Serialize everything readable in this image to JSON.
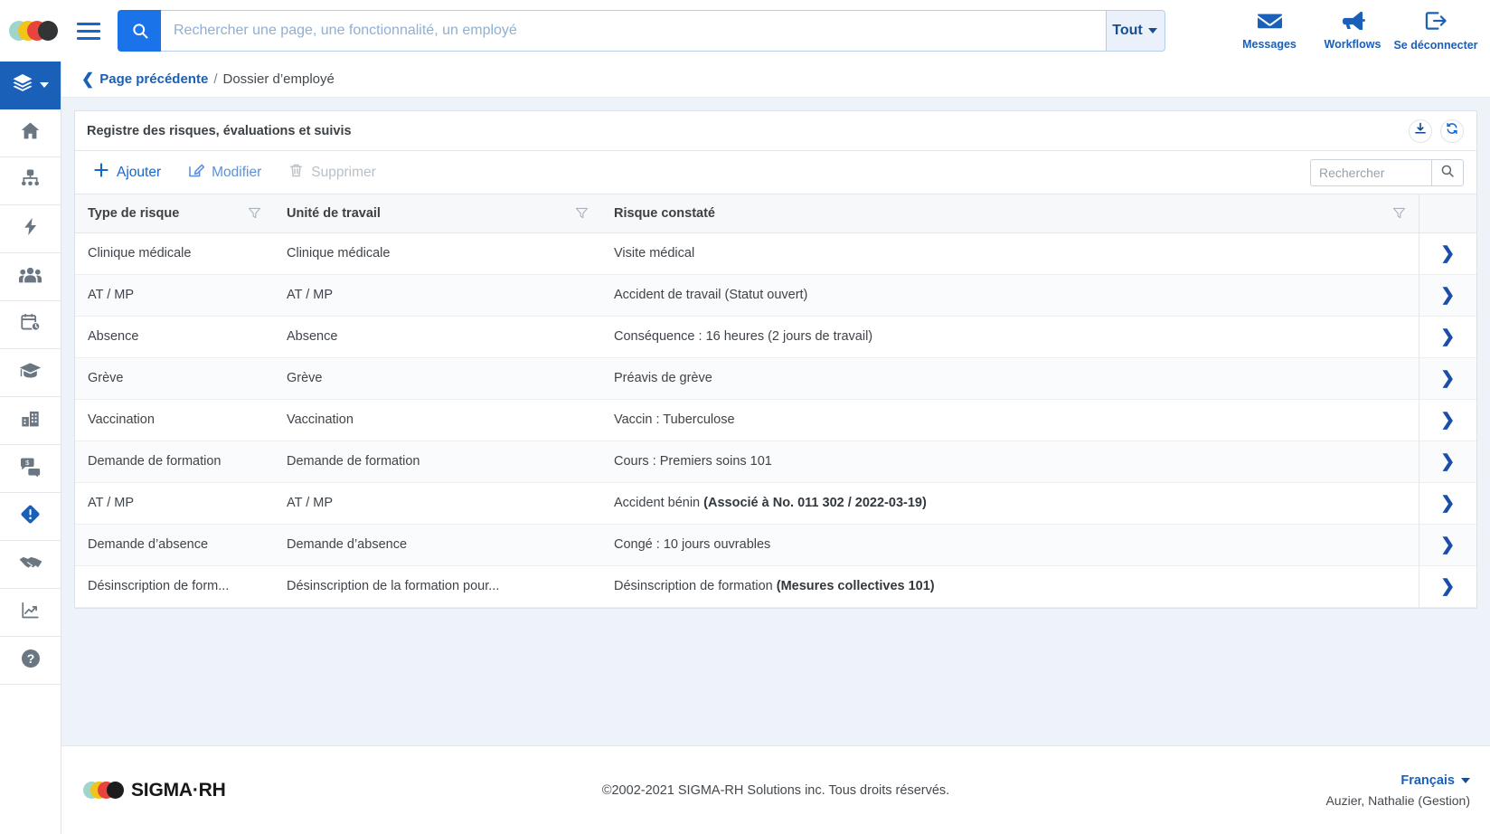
{
  "topbar": {
    "logo_name": "sigma-rh-dots-logo",
    "menu_label": "Menu",
    "search": {
      "placeholder": "Rechercher une page, une fonctionnalité, un employé",
      "value": "",
      "scope_label": "Tout"
    },
    "actions": [
      {
        "label": "Messages",
        "icon": "envelope-icon"
      },
      {
        "label": "Workflows",
        "icon": "megaphone-icon"
      },
      {
        "label": "Se déconnecter",
        "icon": "logout-icon"
      }
    ]
  },
  "sidebar": {
    "items": [
      {
        "name": "layers",
        "icon": "layers-icon",
        "active": true
      },
      {
        "name": "accueil",
        "icon": "home-icon",
        "active": false
      },
      {
        "name": "organigramme",
        "icon": "org-chart-icon",
        "active": false
      },
      {
        "name": "actions-rapides",
        "icon": "lightning-icon",
        "active": false
      },
      {
        "name": "employes",
        "icon": "people-icon",
        "active": false
      },
      {
        "name": "temps-presences",
        "icon": "calendar-clock-icon",
        "active": false
      },
      {
        "name": "formation",
        "icon": "graduation-cap-icon",
        "active": false
      },
      {
        "name": "entreprise",
        "icon": "building-icon",
        "active": false
      },
      {
        "name": "remuneration",
        "icon": "money-chat-icon",
        "active": false
      },
      {
        "name": "sante-securite",
        "icon": "alert-diamond-icon",
        "active": false
      },
      {
        "name": "relations-travail",
        "icon": "handshake-icon",
        "active": false
      },
      {
        "name": "rapports",
        "icon": "chart-line-icon",
        "active": false
      },
      {
        "name": "aide",
        "icon": "help-circle-icon",
        "active": false
      }
    ]
  },
  "breadcrumb": {
    "back_label": "Page précédente",
    "separator": "/",
    "current": "Dossier d’employé"
  },
  "panel": {
    "title": "Registre des risques, évaluations et suivis",
    "header_actions": [
      {
        "label": "Exporter",
        "icon": "download-icon"
      },
      {
        "label": "Rafraîchir",
        "icon": "refresh-icon"
      }
    ],
    "toolbar": {
      "add_label": "Ajouter",
      "edit_label": "Modifier",
      "delete_label": "Supprimer",
      "search_placeholder": "Rechercher",
      "search_value": ""
    },
    "table": {
      "columns": [
        {
          "label": "Type de risque",
          "filter": true
        },
        {
          "label": "Unité de travail",
          "filter": true
        },
        {
          "label": "Risque constaté",
          "filter": true
        }
      ],
      "rows": [
        {
          "type": "Clinique médicale",
          "unite": "Clinique médicale",
          "risque": "Visite médical",
          "risque_bold": ""
        },
        {
          "type": "AT / MP",
          "unite": "AT / MP",
          "risque": "Accident de travail (Statut ouvert)",
          "risque_bold": ""
        },
        {
          "type": "Absence",
          "unite": "Absence",
          "risque": "Conséquence : 16 heures (2 jours de travail)",
          "risque_bold": ""
        },
        {
          "type": "Grève",
          "unite": "Grève",
          "risque": "Préavis de grève",
          "risque_bold": ""
        },
        {
          "type": "Vaccination",
          "unite": "Vaccination",
          "risque": "Vaccin : Tuberculose",
          "risque_bold": ""
        },
        {
          "type": "Demande de formation",
          "unite": "Demande de formation",
          "risque": "Cours : Premiers soins 101",
          "risque_bold": ""
        },
        {
          "type": "AT / MP",
          "unite": "AT / MP",
          "risque": "Accident bénin ",
          "risque_bold": "(Associé à No. 011 302 / 2022-03-19)"
        },
        {
          "type": "Demande d’absence",
          "unite": "Demande d’absence",
          "risque": "Congé : 10 jours ouvrables",
          "risque_bold": ""
        },
        {
          "type": "Désinscription de form...",
          "unite": "Désinscription de la formation pour...",
          "risque": "Désinscription de formation ",
          "risque_bold": "(Mesures collectives 101)"
        }
      ],
      "row_action_icon": "chevron-right-icon"
    }
  },
  "footer": {
    "brand": "SIGMA·RH",
    "copyright": "©2002-2021 SIGMA-RH Solutions inc. Tous droits réservés.",
    "language": "Français",
    "user": "Auzier, Nathalie (Gestion)"
  }
}
